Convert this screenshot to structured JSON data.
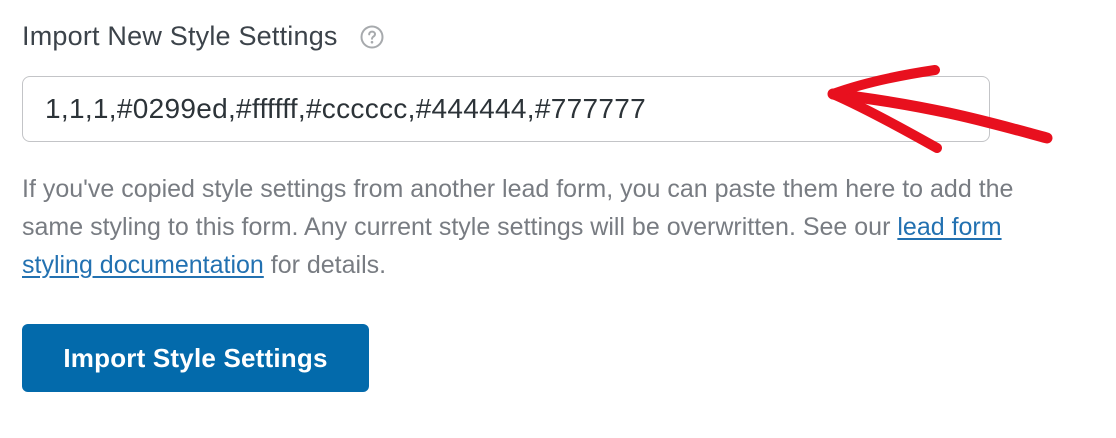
{
  "field": {
    "label": "Import New Style Settings",
    "help_icon": "question-circle-icon",
    "value": "1,1,1,#0299ed,#ffffff,#cccccc,#444444,#777777"
  },
  "description": {
    "before_link": "If you've copied style settings from another lead form, you can paste them here to add the same styling to this form. Any current style settings will be overwritten. See our ",
    "link_text": "lead form styling documentation",
    "after_link": " for details."
  },
  "button": {
    "label": "Import Style Settings"
  },
  "annotation": {
    "icon": "red-arrow-icon",
    "color": "#e8101e"
  },
  "colors": {
    "button_bg": "#036aab",
    "link": "#2271b1",
    "description_text": "#787c82",
    "label_text": "#3c434a"
  }
}
